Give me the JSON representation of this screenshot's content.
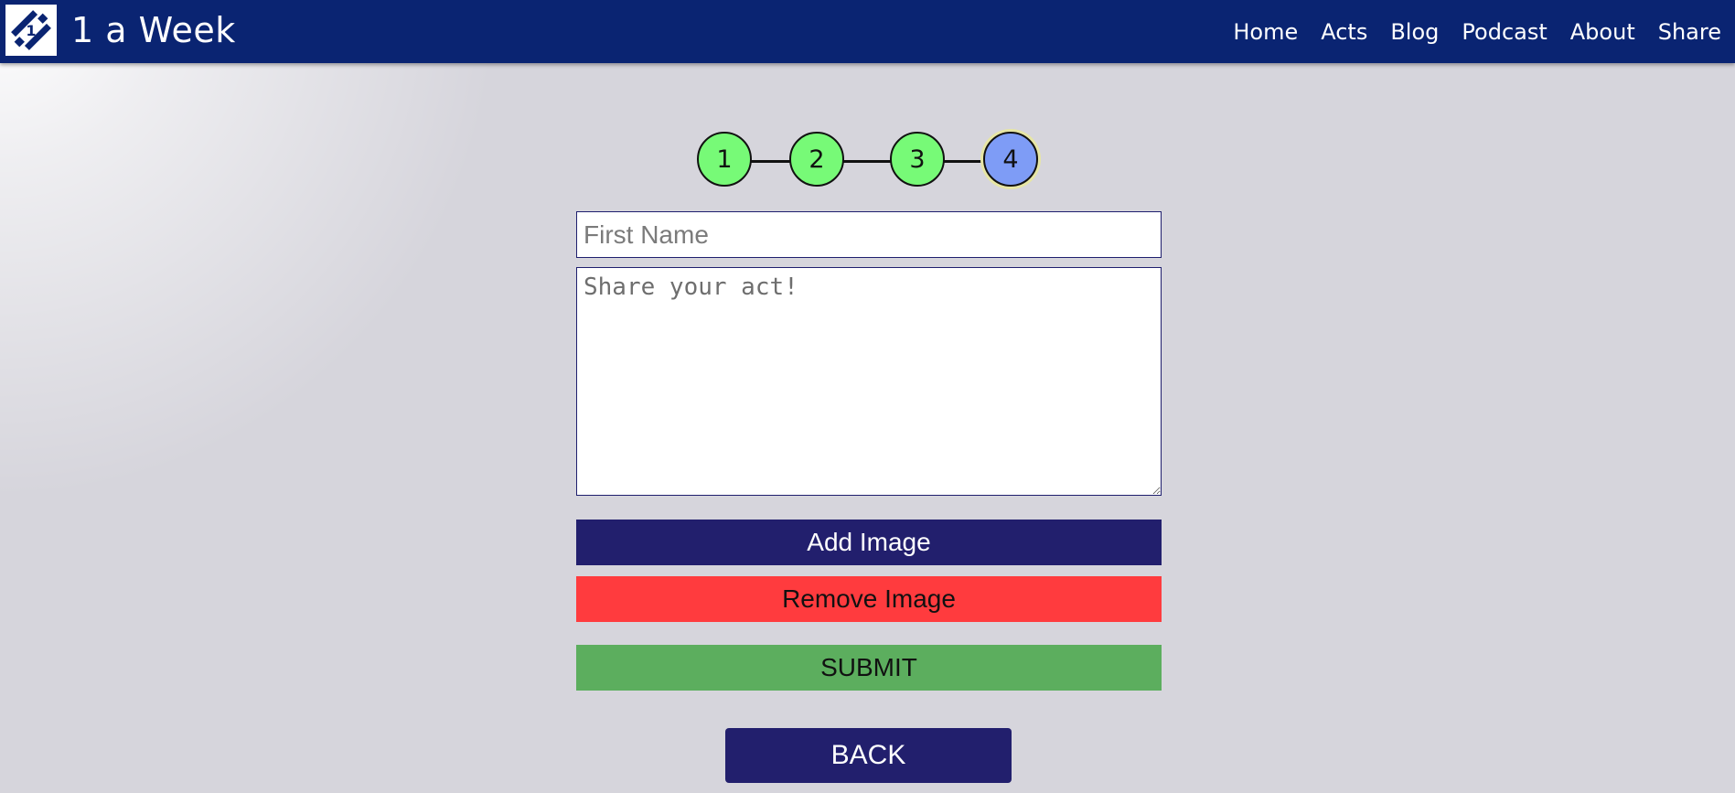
{
  "header": {
    "brand_name": "1 a Week",
    "logo_icon": "logo-icon",
    "nav": [
      "Home",
      "Acts",
      "Blog",
      "Podcast",
      "About",
      "Share"
    ]
  },
  "stepper": {
    "steps": [
      "1",
      "2",
      "3",
      "4"
    ],
    "completed_color": "#77fa77",
    "active_color": "#7e9cf6",
    "active_step": "4"
  },
  "form": {
    "first_name_placeholder": "First Name",
    "act_placeholder": "Share your act!",
    "add_image_label": "Add Image",
    "remove_image_label": "Remove Image",
    "submit_label": "SUBMIT",
    "back_label": "BACK"
  },
  "colors": {
    "navbar": "#0a2472",
    "primary_button": "#221f6d",
    "danger_button": "#ff3b3e",
    "success_button": "#5cae5e",
    "background": "#d6d5dc"
  }
}
